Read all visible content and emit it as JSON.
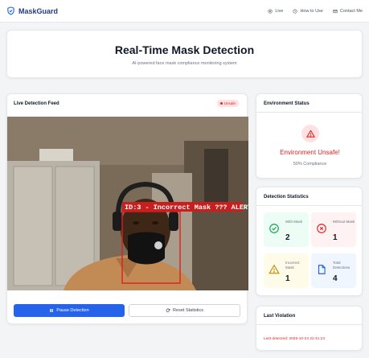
{
  "nav": {
    "brand": "MaskGuard",
    "links": [
      {
        "label": "Live",
        "icon": "eye-icon"
      },
      {
        "label": "How to Use",
        "icon": "clock-icon"
      },
      {
        "label": "Contact Me",
        "icon": "mail-icon"
      }
    ]
  },
  "hero": {
    "title": "Real-Time Mask Detection",
    "subtitle": "AI-powered face mask compliance monitoring system"
  },
  "feed": {
    "title": "Live Detection Feed",
    "badge": "Unsafe",
    "detection_label": "ID:3 - Incorrect Mask ??? ALERT",
    "pause_label": "Pause Detection",
    "reset_label": "Reset Statistics"
  },
  "environment": {
    "title": "Environment Status",
    "status": "Environment Unsafe!",
    "compliance": "50% Compliance"
  },
  "stats": {
    "title": "Detection Statistics",
    "tiles": [
      {
        "label": "With Mask",
        "value": "2",
        "icon": "check-circle-icon",
        "color": "#16a34a"
      },
      {
        "label": "Without Mask",
        "value": "1",
        "icon": "x-circle-icon",
        "color": "#dc2626"
      },
      {
        "label": "Incorrect Mask",
        "value": "1",
        "icon": "warning-icon",
        "color": "#ca8a04"
      },
      {
        "label": "Total Detections",
        "value": "4",
        "icon": "document-icon",
        "color": "#2563eb"
      }
    ]
  },
  "violation": {
    "title": "Last Violation",
    "text": "Last detected: 2025-10-24 22:41:24"
  },
  "colors": {
    "primary": "#2563eb",
    "danger": "#dc2626",
    "brand": "#1e3a8a"
  }
}
